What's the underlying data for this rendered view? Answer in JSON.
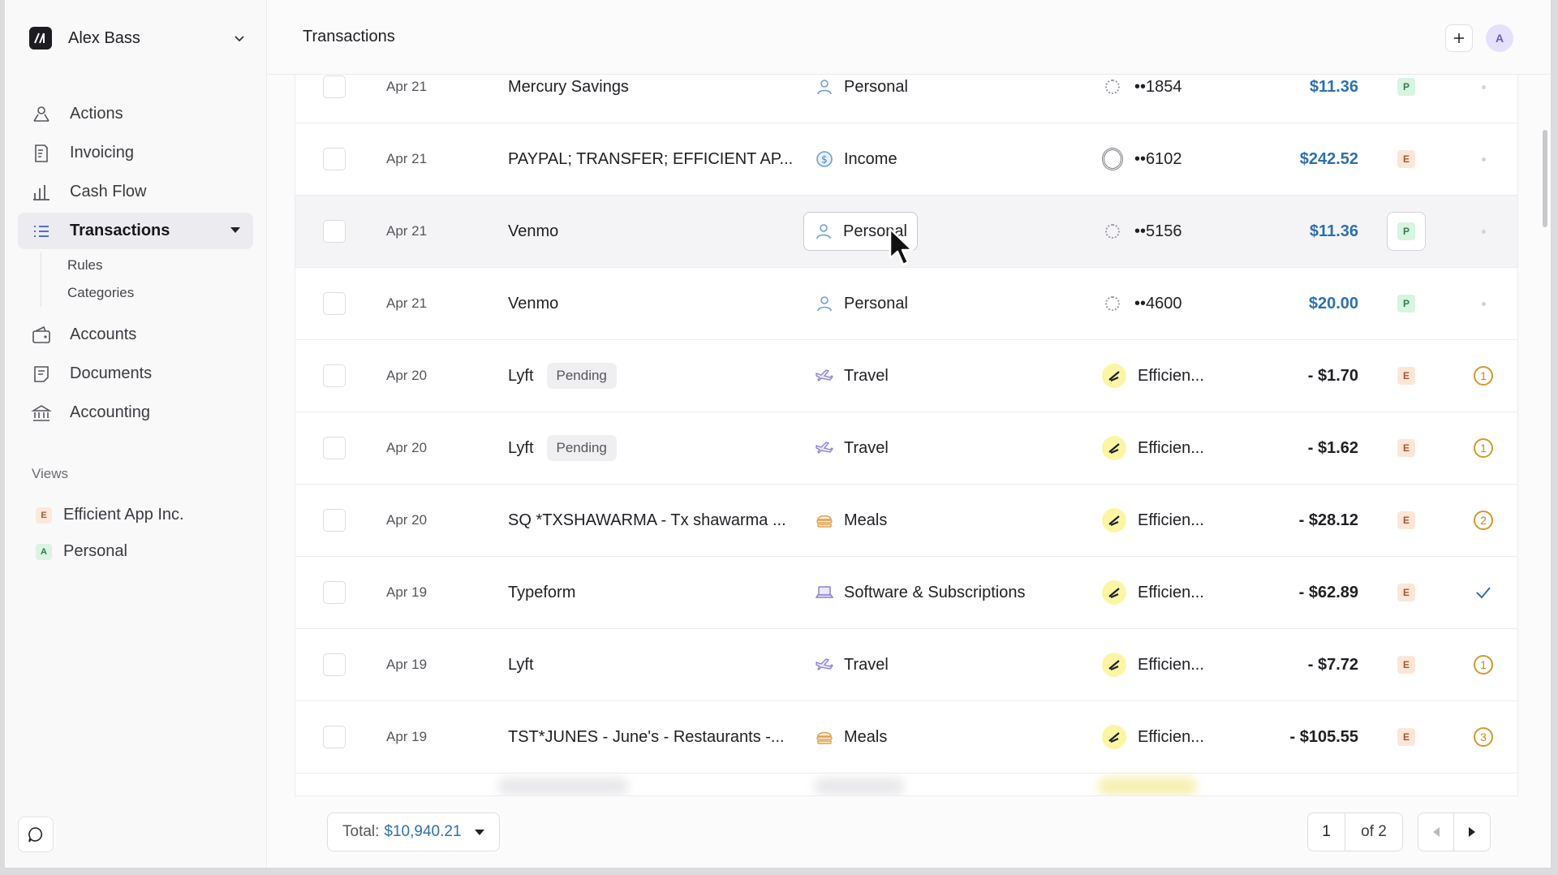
{
  "sidebar": {
    "org_name": "Alex Bass",
    "nav": [
      {
        "label": "Actions",
        "icon": "actions-icon"
      },
      {
        "label": "Invoicing",
        "icon": "invoice-icon"
      },
      {
        "label": "Cash Flow",
        "icon": "bar-chart-icon"
      },
      {
        "label": "Transactions",
        "icon": "list-icon"
      },
      {
        "label": "Accounts",
        "icon": "wallet-icon"
      },
      {
        "label": "Documents",
        "icon": "document-icon"
      },
      {
        "label": "Accounting",
        "icon": "bank-icon"
      }
    ],
    "subnav": [
      "Rules",
      "Categories"
    ],
    "views_title": "Views",
    "views": [
      {
        "badge": "E",
        "label": "Efficient App Inc."
      },
      {
        "badge": "A",
        "label": "Personal"
      }
    ]
  },
  "header": {
    "title": "Transactions",
    "avatar": "A"
  },
  "transactions": [
    {
      "date": "Apr 21",
      "merchant": "Mercury Savings",
      "pending": "",
      "category": "Personal",
      "account": "••1854",
      "amount": "$11.36",
      "tag": "P",
      "status": ""
    },
    {
      "date": "Apr 21",
      "merchant": "PAYPAL; TRANSFER; EFFICIENT AP...",
      "pending": "",
      "category": "Income",
      "account": "••6102",
      "amount": "$242.52",
      "tag": "E",
      "status": ""
    },
    {
      "date": "Apr 21",
      "merchant": "Venmo",
      "pending": "",
      "category": "Personal",
      "account": "••5156",
      "amount": "$11.36",
      "tag": "P",
      "status": ""
    },
    {
      "date": "Apr 21",
      "merchant": "Venmo",
      "pending": "",
      "category": "Personal",
      "account": "••4600",
      "amount": "$20.00",
      "tag": "P",
      "status": ""
    },
    {
      "date": "Apr 20",
      "merchant": "Lyft",
      "pending": "Pending",
      "category": "Travel",
      "account": "Efficien...",
      "amount": "- $1.70",
      "tag": "E",
      "status": "1"
    },
    {
      "date": "Apr 20",
      "merchant": "Lyft",
      "pending": "Pending",
      "category": "Travel",
      "account": "Efficien...",
      "amount": "- $1.62",
      "tag": "E",
      "status": "1"
    },
    {
      "date": "Apr 20",
      "merchant": "SQ *TXSHAWARMA - Tx shawarma ...",
      "pending": "",
      "category": "Meals",
      "account": "Efficien...",
      "amount": "- $28.12",
      "tag": "E",
      "status": "2"
    },
    {
      "date": "Apr 19",
      "merchant": "Typeform",
      "pending": "",
      "category": "Software & Subscriptions",
      "account": "Efficien...",
      "amount": "- $62.89",
      "tag": "E",
      "status": "✓"
    },
    {
      "date": "Apr 19",
      "merchant": "Lyft",
      "pending": "",
      "category": "Travel",
      "account": "Efficien...",
      "amount": "- $7.72",
      "tag": "E",
      "status": "1"
    },
    {
      "date": "Apr 19",
      "merchant": "TST*JUNES - June's - Restaurants -...",
      "pending": "",
      "category": "Meals",
      "account": "Efficien...",
      "amount": "- $105.55",
      "tag": "E",
      "status": "3"
    }
  ],
  "footer": {
    "total_label": "Total:",
    "total_value": "$10,940.21",
    "page": "1",
    "of_pages": "of 2"
  },
  "colors": {
    "positive_amount": "#2d71ad",
    "tag_personal": "#d6f4e0",
    "tag_efficient": "#fde6d8",
    "status_pending": "#d29a2c",
    "status_done": "#2d71ad"
  }
}
